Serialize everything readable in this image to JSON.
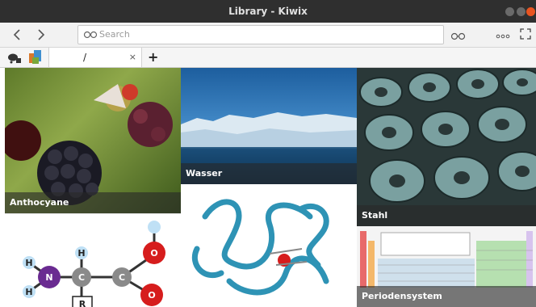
{
  "window": {
    "title": "Library - Kiwix"
  },
  "toolbar": {
    "search_placeholder": "Search"
  },
  "tabs": [
    {
      "label": "/",
      "close": "×"
    }
  ],
  "new_tab_label": "+",
  "tiles": [
    {
      "caption": "Anthocyane"
    },
    {
      "caption": "Wasser"
    },
    {
      "caption": "Stahl"
    },
    {
      "caption": ""
    },
    {
      "caption": ""
    },
    {
      "caption": "Periodensystem"
    }
  ],
  "molecule": {
    "atoms": [
      "H",
      "H",
      "H",
      "N",
      "C",
      "C",
      "O",
      "O",
      "R"
    ]
  },
  "colors": {
    "titlebar": "#2f2f2f",
    "close": "#e95420",
    "caption_bg": "#3a3a3a"
  }
}
